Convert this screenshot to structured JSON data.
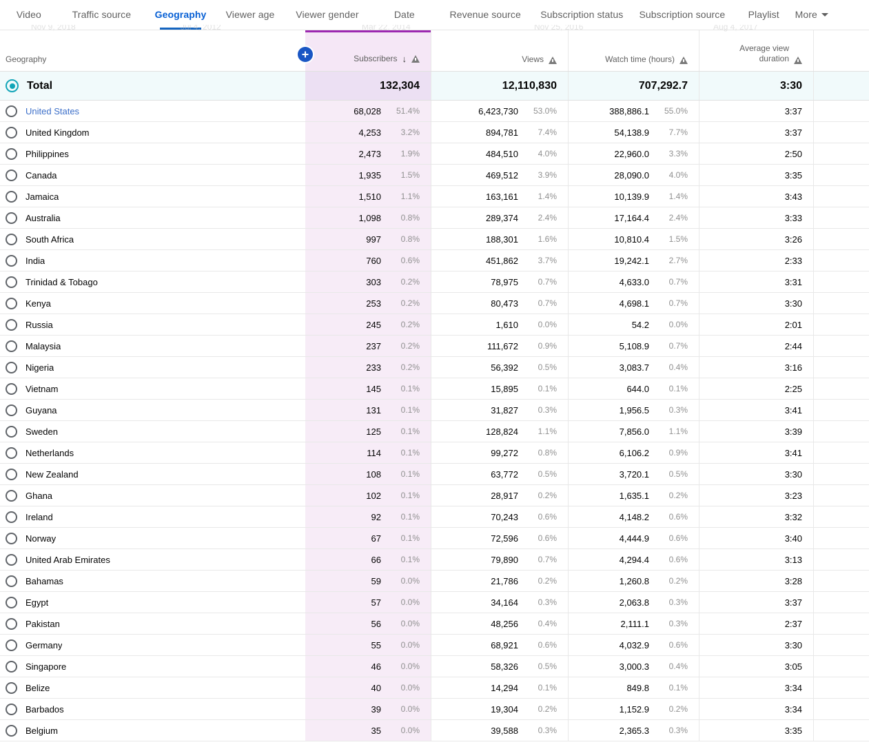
{
  "tabs": [
    {
      "label": "Video",
      "active": false
    },
    {
      "label": "Traffic source",
      "active": false
    },
    {
      "label": "Geography",
      "active": true
    },
    {
      "label": "Viewer age",
      "active": false
    },
    {
      "label": "Viewer gender",
      "active": false
    },
    {
      "label": "Date",
      "active": false
    },
    {
      "label": "Revenue source",
      "active": false
    },
    {
      "label": "Subscription status",
      "active": false
    },
    {
      "label": "Subscription source",
      "active": false
    },
    {
      "label": "Playlist",
      "active": false
    },
    {
      "label": "More",
      "active": false
    }
  ],
  "ghost_dates": [
    "Nov 9, 2018",
    "Jul 4, 2012",
    "Mar 22, 2014",
    "Nov 25, 2016",
    "Aug 4, 2017"
  ],
  "table": {
    "columns": {
      "geography": "Geography",
      "subscribers": "Subscribers",
      "views": "Views",
      "watch_time": "Watch time (hours)",
      "average_view_duration_line1": "Average view",
      "average_view_duration_line2": "duration"
    },
    "sort": {
      "column": "Subscribers",
      "direction": "descending",
      "glyph": "↓"
    },
    "add_metric_button_label": "+",
    "total": {
      "label": "Total",
      "subscribers": "132,304",
      "views": "12,110,830",
      "watch_time": "707,292.7",
      "average_view_duration": "3:30"
    },
    "rows": [
      {
        "geography": "United States",
        "is_link": true,
        "subscribers": "68,028",
        "subscribers_pct": "51.4%",
        "views": "6,423,730",
        "views_pct": "53.0%",
        "watch_time": "388,886.1",
        "watch_time_pct": "55.0%",
        "average_view_duration": "3:37"
      },
      {
        "geography": "United Kingdom",
        "is_link": false,
        "subscribers": "4,253",
        "subscribers_pct": "3.2%",
        "views": "894,781",
        "views_pct": "7.4%",
        "watch_time": "54,138.9",
        "watch_time_pct": "7.7%",
        "average_view_duration": "3:37"
      },
      {
        "geography": "Philippines",
        "is_link": false,
        "subscribers": "2,473",
        "subscribers_pct": "1.9%",
        "views": "484,510",
        "views_pct": "4.0%",
        "watch_time": "22,960.0",
        "watch_time_pct": "3.3%",
        "average_view_duration": "2:50"
      },
      {
        "geography": "Canada",
        "is_link": false,
        "subscribers": "1,935",
        "subscribers_pct": "1.5%",
        "views": "469,512",
        "views_pct": "3.9%",
        "watch_time": "28,090.0",
        "watch_time_pct": "4.0%",
        "average_view_duration": "3:35"
      },
      {
        "geography": "Jamaica",
        "is_link": false,
        "subscribers": "1,510",
        "subscribers_pct": "1.1%",
        "views": "163,161",
        "views_pct": "1.4%",
        "watch_time": "10,139.9",
        "watch_time_pct": "1.4%",
        "average_view_duration": "3:43"
      },
      {
        "geography": "Australia",
        "is_link": false,
        "subscribers": "1,098",
        "subscribers_pct": "0.8%",
        "views": "289,374",
        "views_pct": "2.4%",
        "watch_time": "17,164.4",
        "watch_time_pct": "2.4%",
        "average_view_duration": "3:33"
      },
      {
        "geography": "South Africa",
        "is_link": false,
        "subscribers": "997",
        "subscribers_pct": "0.8%",
        "views": "188,301",
        "views_pct": "1.6%",
        "watch_time": "10,810.4",
        "watch_time_pct": "1.5%",
        "average_view_duration": "3:26"
      },
      {
        "geography": "India",
        "is_link": false,
        "subscribers": "760",
        "subscribers_pct": "0.6%",
        "views": "451,862",
        "views_pct": "3.7%",
        "watch_time": "19,242.1",
        "watch_time_pct": "2.7%",
        "average_view_duration": "2:33"
      },
      {
        "geography": "Trinidad & Tobago",
        "is_link": false,
        "subscribers": "303",
        "subscribers_pct": "0.2%",
        "views": "78,975",
        "views_pct": "0.7%",
        "watch_time": "4,633.0",
        "watch_time_pct": "0.7%",
        "average_view_duration": "3:31"
      },
      {
        "geography": "Kenya",
        "is_link": false,
        "subscribers": "253",
        "subscribers_pct": "0.2%",
        "views": "80,473",
        "views_pct": "0.7%",
        "watch_time": "4,698.1",
        "watch_time_pct": "0.7%",
        "average_view_duration": "3:30"
      },
      {
        "geography": "Russia",
        "is_link": false,
        "subscribers": "245",
        "subscribers_pct": "0.2%",
        "views": "1,610",
        "views_pct": "0.0%",
        "watch_time": "54.2",
        "watch_time_pct": "0.0%",
        "average_view_duration": "2:01"
      },
      {
        "geography": "Malaysia",
        "is_link": false,
        "subscribers": "237",
        "subscribers_pct": "0.2%",
        "views": "111,672",
        "views_pct": "0.9%",
        "watch_time": "5,108.9",
        "watch_time_pct": "0.7%",
        "average_view_duration": "2:44"
      },
      {
        "geography": "Nigeria",
        "is_link": false,
        "subscribers": "233",
        "subscribers_pct": "0.2%",
        "views": "56,392",
        "views_pct": "0.5%",
        "watch_time": "3,083.7",
        "watch_time_pct": "0.4%",
        "average_view_duration": "3:16"
      },
      {
        "geography": "Vietnam",
        "is_link": false,
        "subscribers": "145",
        "subscribers_pct": "0.1%",
        "views": "15,895",
        "views_pct": "0.1%",
        "watch_time": "644.0",
        "watch_time_pct": "0.1%",
        "average_view_duration": "2:25"
      },
      {
        "geography": "Guyana",
        "is_link": false,
        "subscribers": "131",
        "subscribers_pct": "0.1%",
        "views": "31,827",
        "views_pct": "0.3%",
        "watch_time": "1,956.5",
        "watch_time_pct": "0.3%",
        "average_view_duration": "3:41"
      },
      {
        "geography": "Sweden",
        "is_link": false,
        "subscribers": "125",
        "subscribers_pct": "0.1%",
        "views": "128,824",
        "views_pct": "1.1%",
        "watch_time": "7,856.0",
        "watch_time_pct": "1.1%",
        "average_view_duration": "3:39"
      },
      {
        "geography": "Netherlands",
        "is_link": false,
        "subscribers": "114",
        "subscribers_pct": "0.1%",
        "views": "99,272",
        "views_pct": "0.8%",
        "watch_time": "6,106.2",
        "watch_time_pct": "0.9%",
        "average_view_duration": "3:41"
      },
      {
        "geography": "New Zealand",
        "is_link": false,
        "subscribers": "108",
        "subscribers_pct": "0.1%",
        "views": "63,772",
        "views_pct": "0.5%",
        "watch_time": "3,720.1",
        "watch_time_pct": "0.5%",
        "average_view_duration": "3:30"
      },
      {
        "geography": "Ghana",
        "is_link": false,
        "subscribers": "102",
        "subscribers_pct": "0.1%",
        "views": "28,917",
        "views_pct": "0.2%",
        "watch_time": "1,635.1",
        "watch_time_pct": "0.2%",
        "average_view_duration": "3:23"
      },
      {
        "geography": "Ireland",
        "is_link": false,
        "subscribers": "92",
        "subscribers_pct": "0.1%",
        "views": "70,243",
        "views_pct": "0.6%",
        "watch_time": "4,148.2",
        "watch_time_pct": "0.6%",
        "average_view_duration": "3:32"
      },
      {
        "geography": "Norway",
        "is_link": false,
        "subscribers": "67",
        "subscribers_pct": "0.1%",
        "views": "72,596",
        "views_pct": "0.6%",
        "watch_time": "4,444.9",
        "watch_time_pct": "0.6%",
        "average_view_duration": "3:40"
      },
      {
        "geography": "United Arab Emirates",
        "is_link": false,
        "subscribers": "66",
        "subscribers_pct": "0.1%",
        "views": "79,890",
        "views_pct": "0.7%",
        "watch_time": "4,294.4",
        "watch_time_pct": "0.6%",
        "average_view_duration": "3:13"
      },
      {
        "geography": "Bahamas",
        "is_link": false,
        "subscribers": "59",
        "subscribers_pct": "0.0%",
        "views": "21,786",
        "views_pct": "0.2%",
        "watch_time": "1,260.8",
        "watch_time_pct": "0.2%",
        "average_view_duration": "3:28"
      },
      {
        "geography": "Egypt",
        "is_link": false,
        "subscribers": "57",
        "subscribers_pct": "0.0%",
        "views": "34,164",
        "views_pct": "0.3%",
        "watch_time": "2,063.8",
        "watch_time_pct": "0.3%",
        "average_view_duration": "3:37"
      },
      {
        "geography": "Pakistan",
        "is_link": false,
        "subscribers": "56",
        "subscribers_pct": "0.0%",
        "views": "48,256",
        "views_pct": "0.4%",
        "watch_time": "2,111.1",
        "watch_time_pct": "0.3%",
        "average_view_duration": "2:37"
      },
      {
        "geography": "Germany",
        "is_link": false,
        "subscribers": "55",
        "subscribers_pct": "0.0%",
        "views": "68,921",
        "views_pct": "0.6%",
        "watch_time": "4,032.9",
        "watch_time_pct": "0.6%",
        "average_view_duration": "3:30"
      },
      {
        "geography": "Singapore",
        "is_link": false,
        "subscribers": "46",
        "subscribers_pct": "0.0%",
        "views": "58,326",
        "views_pct": "0.5%",
        "watch_time": "3,000.3",
        "watch_time_pct": "0.4%",
        "average_view_duration": "3:05"
      },
      {
        "geography": "Belize",
        "is_link": false,
        "subscribers": "40",
        "subscribers_pct": "0.0%",
        "views": "14,294",
        "views_pct": "0.1%",
        "watch_time": "849.8",
        "watch_time_pct": "0.1%",
        "average_view_duration": "3:34"
      },
      {
        "geography": "Barbados",
        "is_link": false,
        "subscribers": "39",
        "subscribers_pct": "0.0%",
        "views": "19,304",
        "views_pct": "0.2%",
        "watch_time": "1,152.9",
        "watch_time_pct": "0.2%",
        "average_view_duration": "3:34"
      },
      {
        "geography": "Belgium",
        "is_link": false,
        "subscribers": "35",
        "subscribers_pct": "0.0%",
        "views": "39,588",
        "views_pct": "0.3%",
        "watch_time": "2,365.3",
        "watch_time_pct": "0.3%",
        "average_view_duration": "3:35"
      }
    ]
  },
  "colors": {
    "accent_blue": "#065fd4",
    "active_tab_underline": "#1565c0",
    "subscribers_column_highlight": "#9c27b0",
    "total_radio": "#12a5b8",
    "add_button": "#1a56c4"
  }
}
